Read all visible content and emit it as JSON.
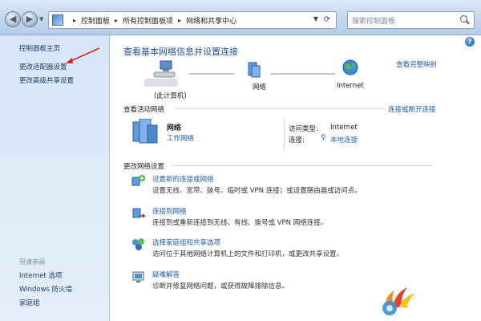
{
  "toolbar": {
    "breadcrumbs": [
      "控制面板",
      "所有控制面板项",
      "网络和共享中心"
    ],
    "search_placeholder": "搜索控制面板"
  },
  "sidebar": {
    "home_link": "控制面板主页",
    "links": [
      "更改适配器设置",
      "更改高级共享设置"
    ],
    "see_also_label": "另请参阅",
    "see_also_items": [
      "Internet 选项",
      "Windows 防火墙",
      "家庭组"
    ]
  },
  "main": {
    "heading": "查看基本网络信息并设置连接",
    "full_map_link": "查看完整映射",
    "network_map": {
      "computer_label": "(此计算机)",
      "network_label": "网络",
      "internet_label": "Internet"
    },
    "active_networks": {
      "title": "查看活动网络",
      "link": "连接或断开连接",
      "network_name": "网络",
      "network_type": "工作网络",
      "access_type_key": "访问类型:",
      "access_type_value": "Internet",
      "connections_key": "连接:",
      "connections_value": "本地连接"
    },
    "change_settings": {
      "title": "更改网络设置",
      "tasks": [
        {
          "link": "设置新的连接或网络",
          "desc": "设置无线、宽带、拨号、临时或 VPN 连接；或设置路由器或访问点。",
          "icon": "new-connection-icon"
        },
        {
          "link": "连接到网络",
          "desc": "连接到或重新连接到无线、有线、拨号或 VPN 网络连接。",
          "icon": "connect-network-icon"
        },
        {
          "link": "选择家庭组和共享选项",
          "desc": "访问位于其他网络计算机上的文件和打印机，或更改共享设置。",
          "icon": "homegroup-icon"
        },
        {
          "link": "疑难解答",
          "desc": "诊断并修复网络问题，或获得故障排除信息。",
          "icon": "troubleshoot-icon"
        }
      ]
    }
  },
  "colors": {
    "link": "#1f5bb5",
    "heading": "#1f4e99",
    "sidebar_bg": "#d7e6f6",
    "annotation_arrow": "#e02020"
  }
}
